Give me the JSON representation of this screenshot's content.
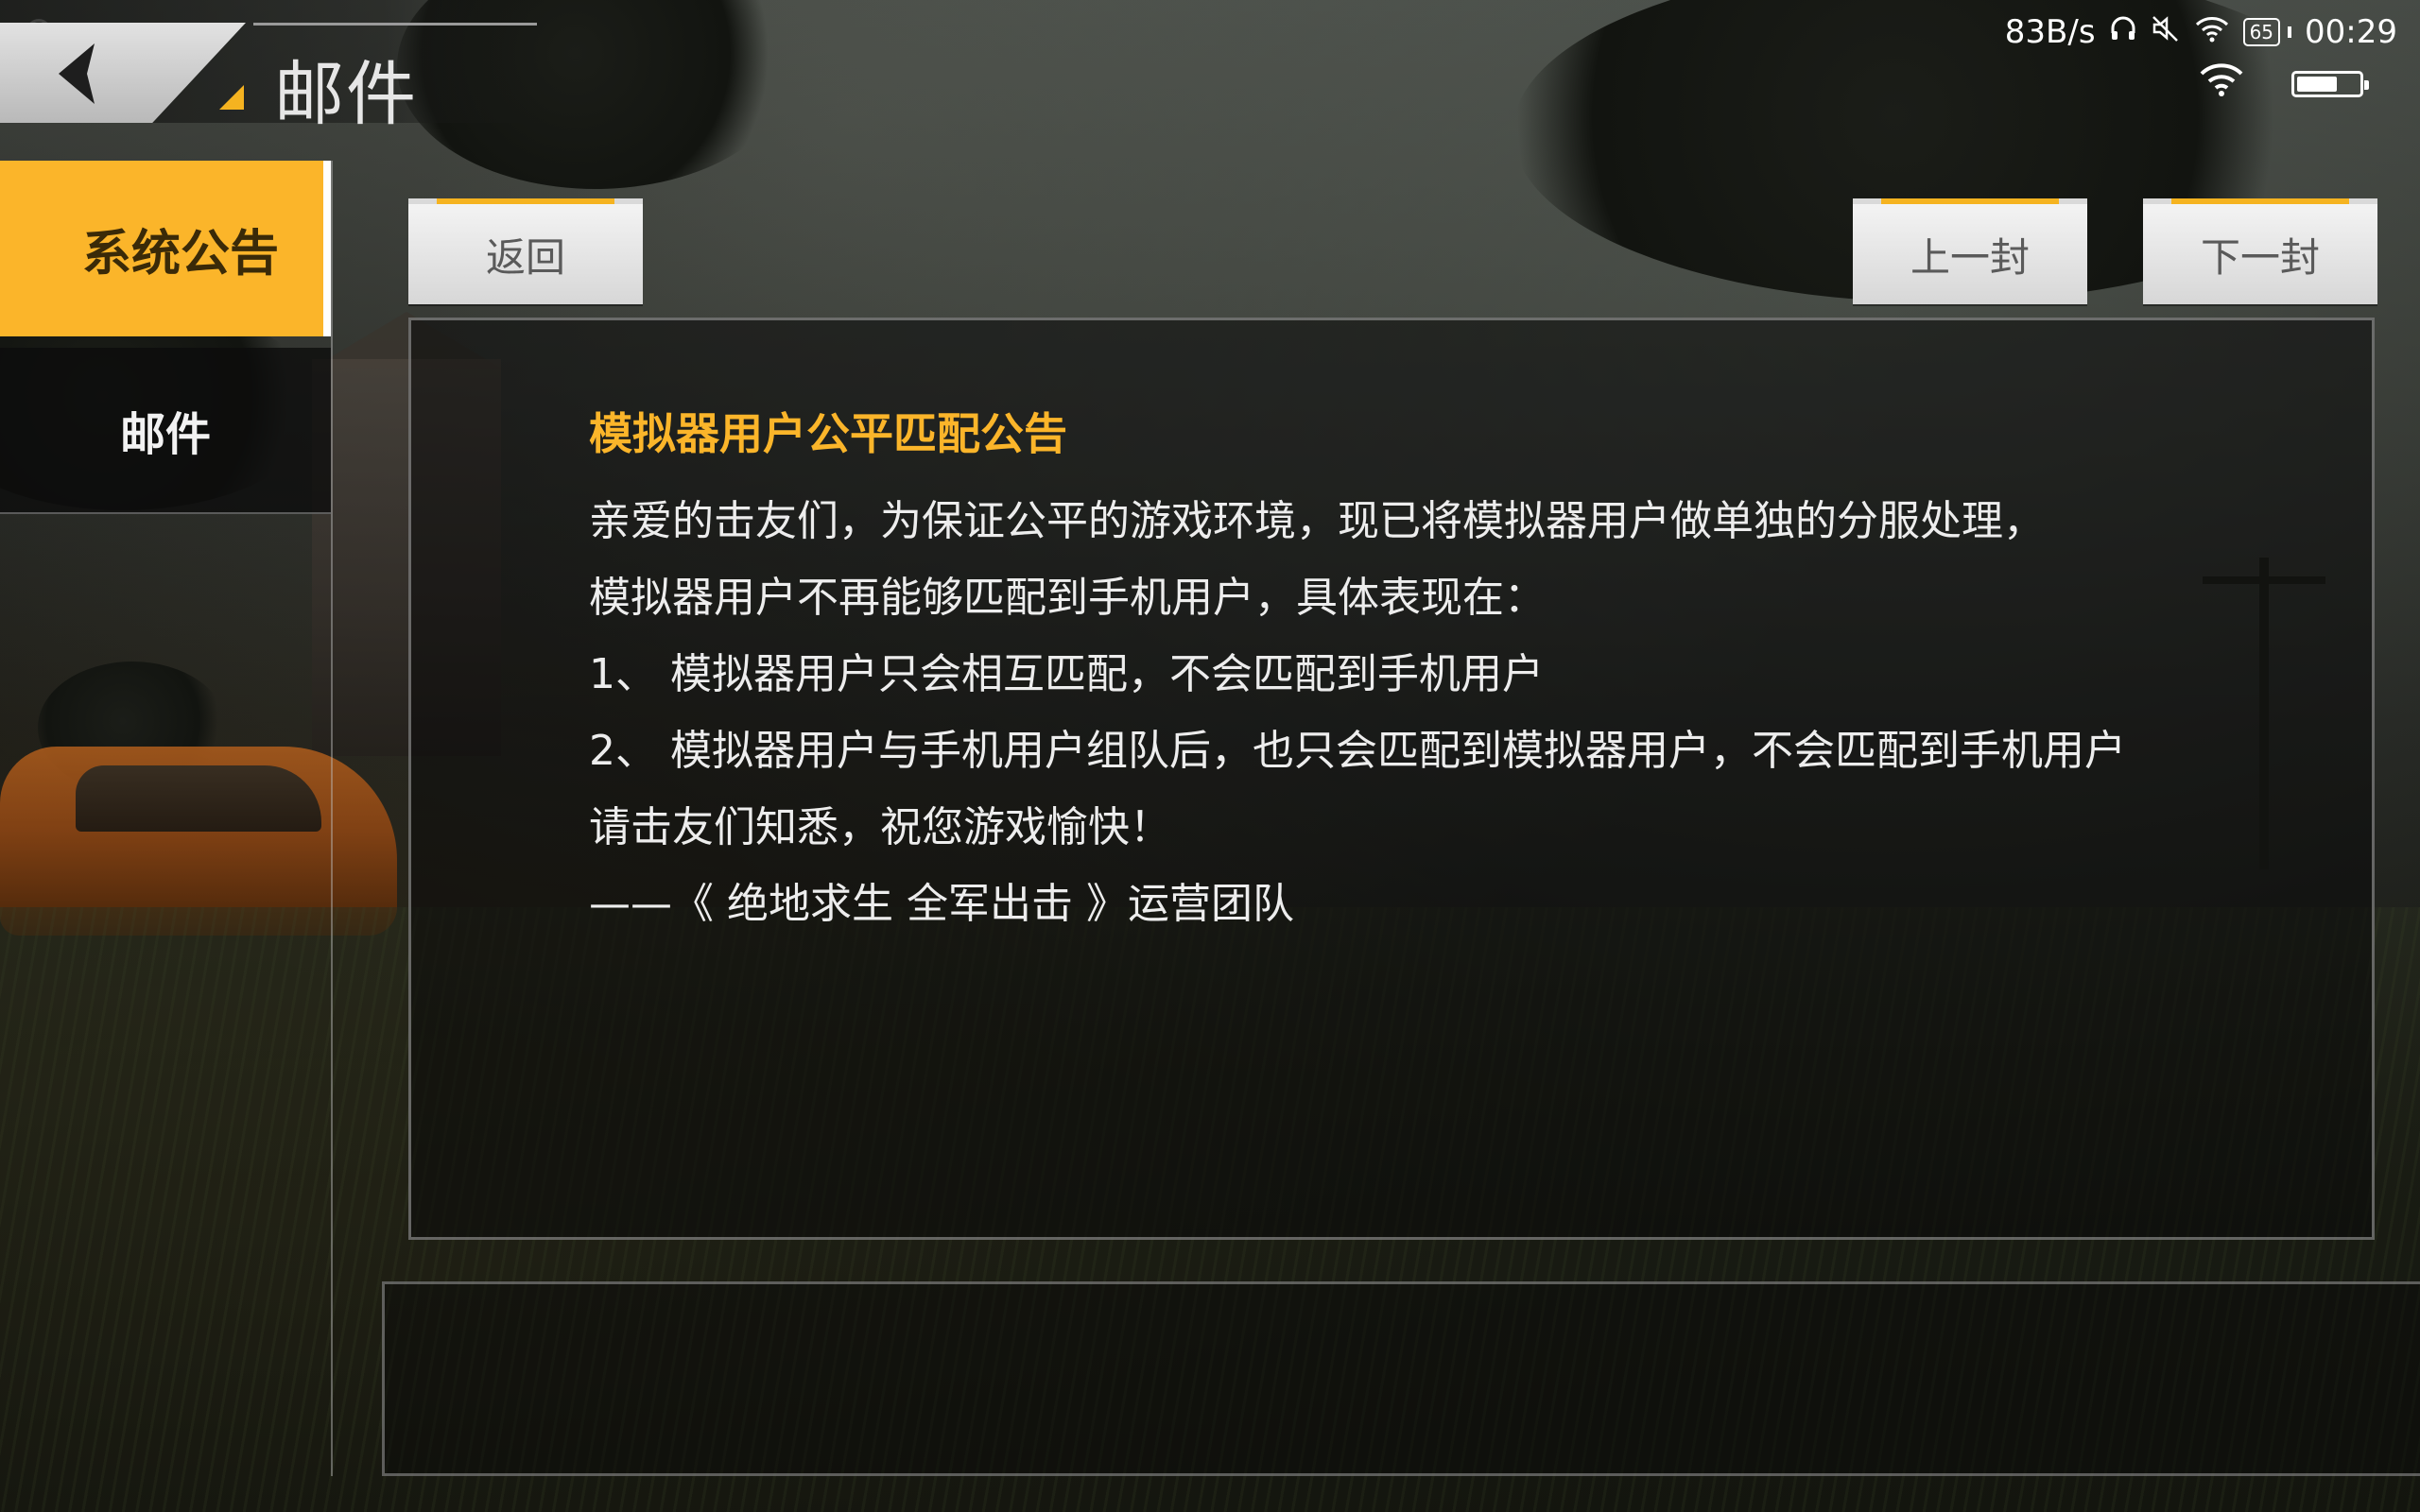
{
  "status_bar": {
    "net_speed": "83B/s",
    "battery_percent": "65",
    "battery_level": 0.65,
    "time": "00:29",
    "icons": [
      "timer-icon",
      "headphones-icon",
      "mute-icon",
      "wifi-icon",
      "battery-icon"
    ]
  },
  "header": {
    "title": "邮件",
    "back_icon": "chevron-left-icon"
  },
  "sidebar": {
    "items": [
      {
        "label": "系统公告",
        "active": true
      },
      {
        "label": "邮件",
        "active": false
      }
    ]
  },
  "buttons": {
    "back": "返回",
    "prev": "上一封",
    "next": "下一封"
  },
  "mail": {
    "title": "模拟器用户公平匹配公告",
    "lines": [
      "亲爱的击友们，为保证公平的游戏环境，现已将模拟器用户做单独的分服处理，",
      "模拟器用户不再能够匹配到手机用户，具体表现在：",
      "1、 模拟器用户只会相互匹配，不会匹配到手机用户",
      "2、 模拟器用户与手机用户组队后，也只会匹配到模拟器用户，不会匹配到手机用户",
      "请击友们知悉，祝您游戏愉快！",
      "——《 绝地求生 全军出击 》运营团队"
    ]
  },
  "colors": {
    "accent": "#fbb52a",
    "title_text": "#fbb52a",
    "body_text": "#ededed"
  }
}
